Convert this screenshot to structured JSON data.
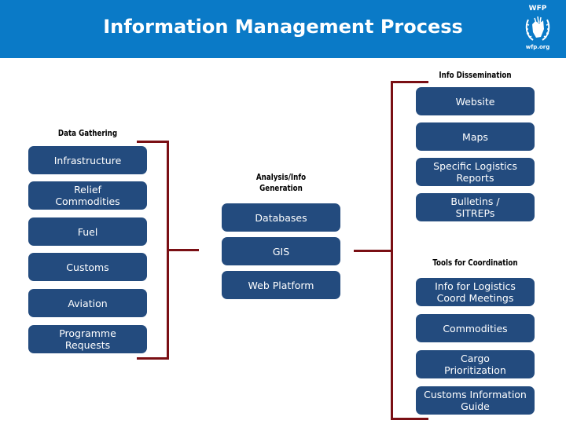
{
  "header": {
    "title": "Information Management Process",
    "logo": {
      "name": "WFP",
      "url_text": "wfp.org",
      "icon": "wfp-emblem-icon"
    },
    "background_color": "#0a7ac7"
  },
  "colors": {
    "box": "#234b7e",
    "bracket": "#7a0f14",
    "box_text": "#ffffff"
  },
  "data_gathering": {
    "label": "Data Gathering",
    "items": [
      "Infrastructure",
      "Relief Commodities",
      "Fuel",
      "Customs",
      "Aviation",
      "Programme Requests"
    ]
  },
  "analysis": {
    "label_line1": "Analysis/Info",
    "label_line2": "Generation",
    "items": [
      "Databases",
      "GIS",
      "Web Platform"
    ]
  },
  "info_dissemination": {
    "label": "Info Dissemination",
    "items": [
      "Website",
      "Maps",
      "Specific Logistics Reports",
      "Bulletins / SITREPs"
    ]
  },
  "tools_for_coordination": {
    "label": "Tools for Coordination",
    "items": [
      "Info for Logistics Coord Meetings",
      "Commodities",
      "Cargo Prioritization",
      "Customs Information Guide"
    ]
  }
}
